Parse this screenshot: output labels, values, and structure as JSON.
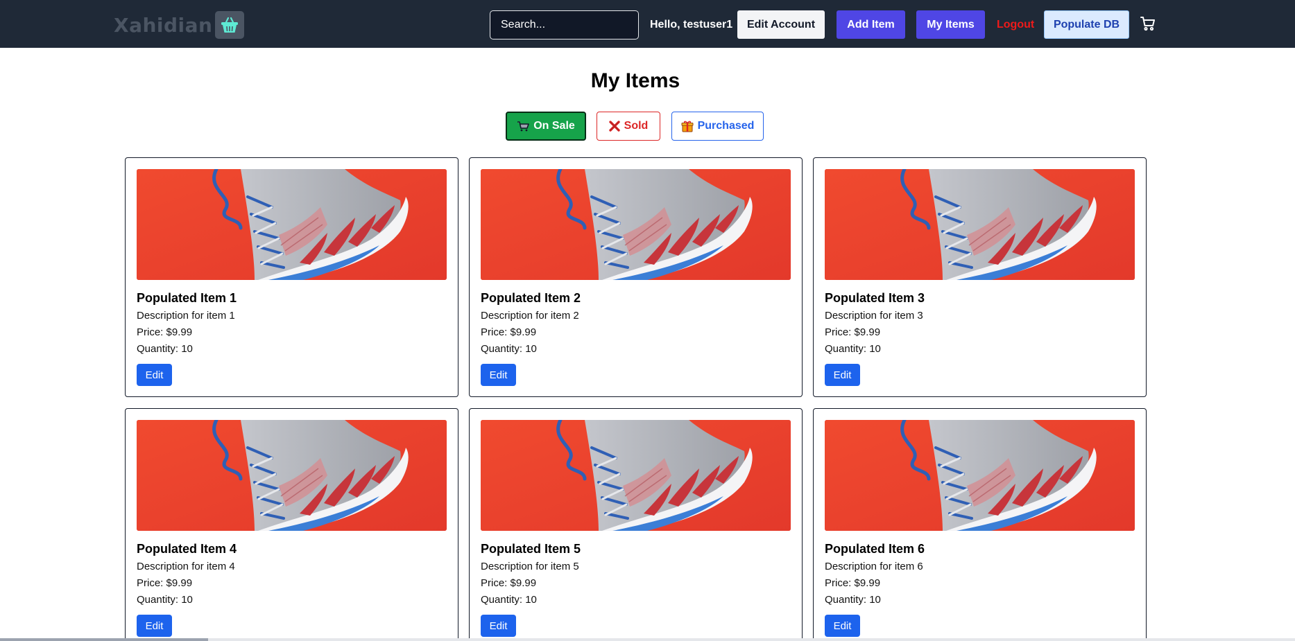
{
  "navbar": {
    "logo_text": "Xahidian",
    "logo_icon": "basket-icon",
    "search_placeholder": "Search...",
    "greeting": "Hello, testuser1",
    "edit_account_label": "Edit Account",
    "add_item_label": "Add Item",
    "my_items_label": "My Items",
    "logout_label": "Logout",
    "populate_db_label": "Populate DB",
    "cart_icon": "cart-icon"
  },
  "page": {
    "title": "My Items"
  },
  "filters": [
    {
      "label": "On Sale",
      "icon": "cart-icon",
      "active": true
    },
    {
      "label": "Sold",
      "icon": "cross-mark-icon",
      "active": false
    },
    {
      "label": "Purchased",
      "icon": "gift-icon",
      "active": false
    }
  ],
  "items": [
    {
      "title": "Populated Item 1",
      "description": "Description for item 1",
      "price": "Price: $9.99",
      "quantity": "Quantity: 10",
      "edit_label": "Edit"
    },
    {
      "title": "Populated Item 2",
      "description": "Description for item 2",
      "price": "Price: $9.99",
      "quantity": "Quantity: 10",
      "edit_label": "Edit"
    },
    {
      "title": "Populated Item 3",
      "description": "Description for item 3",
      "price": "Price: $9.99",
      "quantity": "Quantity: 10",
      "edit_label": "Edit"
    },
    {
      "title": "Populated Item 4",
      "description": "Description for item 4",
      "price": "Price: $9.99",
      "quantity": "Quantity: 10",
      "edit_label": "Edit"
    },
    {
      "title": "Populated Item 5",
      "description": "Description for item 5",
      "price": "Price: $9.99",
      "quantity": "Quantity: 10",
      "edit_label": "Edit"
    },
    {
      "title": "Populated Item 6",
      "description": "Description for item 6",
      "price": "Price: $9.99",
      "quantity": "Quantity: 10",
      "edit_label": "Edit"
    }
  ],
  "colors": {
    "navbar_bg": "#1f2937",
    "primary_indigo": "#4f46e5",
    "on_sale_green": "#16a34a",
    "sold_red": "#dc2626",
    "purchased_blue": "#2563eb",
    "edit_blue": "#1d63ed",
    "item_image_red": "#e8402c"
  }
}
